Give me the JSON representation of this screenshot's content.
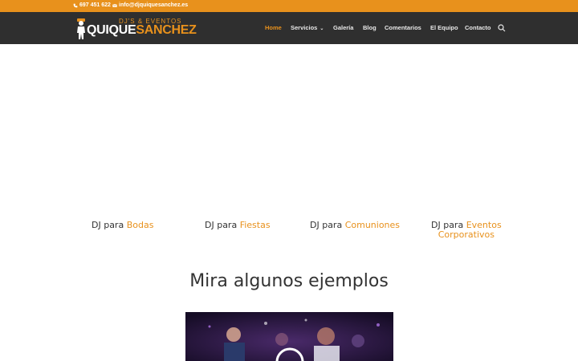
{
  "topbar": {
    "phone": "697 451 622",
    "email": "info@djquiquesanchez.es"
  },
  "logo": {
    "tagline": "DJ'S & EVENTOS",
    "name_first": "QUIQUE",
    "name_second": "SANCHEZ"
  },
  "nav": {
    "items": [
      {
        "label": "Home"
      },
      {
        "label": "Servicios"
      },
      {
        "label": "Galería"
      },
      {
        "label": "Blog"
      },
      {
        "label": "Comentarios"
      },
      {
        "label": "El Equipo"
      },
      {
        "label": "Contacto"
      }
    ]
  },
  "services": [
    {
      "prefix": "DJ para",
      "accent": "Bodas",
      "accent2": ""
    },
    {
      "prefix": "DJ para",
      "accent": "Fiestas",
      "accent2": ""
    },
    {
      "prefix": "DJ para",
      "accent": "Comuniones",
      "accent2": ""
    },
    {
      "prefix": "DJ para",
      "accent": "Eventos",
      "accent2": "Corporativos"
    }
  ],
  "section": {
    "title": "Mira algunos ejemplos"
  },
  "colors": {
    "accent": "#e8911c",
    "header_bg": "#2f2f2f",
    "text": "#333333"
  }
}
